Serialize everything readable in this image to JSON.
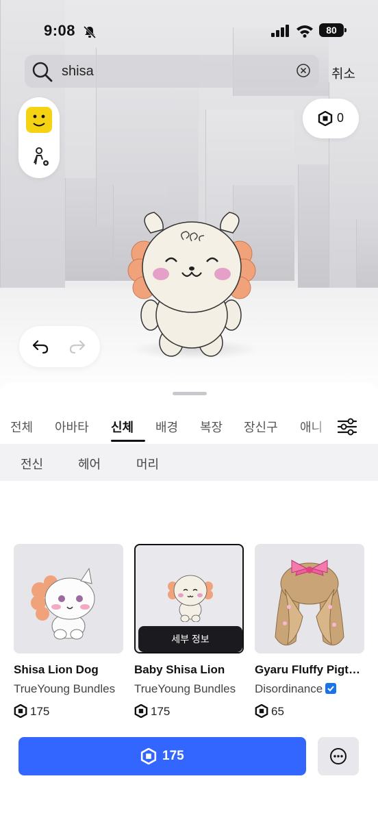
{
  "status": {
    "time": "9:08",
    "battery": "80"
  },
  "search": {
    "value": "shisa",
    "cancel_label": "취소"
  },
  "robux_balance": "0",
  "tabs": [
    {
      "label": "전체",
      "active": false
    },
    {
      "label": "아바타",
      "active": false
    },
    {
      "label": "신체",
      "active": true
    },
    {
      "label": "배경",
      "active": false
    },
    {
      "label": "복장",
      "active": false
    },
    {
      "label": "장신구",
      "active": false
    },
    {
      "label": "애니",
      "active": false
    }
  ],
  "subtabs": [
    {
      "label": "전신"
    },
    {
      "label": "헤어"
    },
    {
      "label": "머리"
    }
  ],
  "items": [
    {
      "name": "Shisa Lion Dog",
      "creator": "TrueYoung Bundles",
      "price": "175",
      "selected": false
    },
    {
      "name": "Baby Shisa Lion",
      "creator": "TrueYoung Bundles",
      "price": "175",
      "selected": true,
      "detail_label": "세부 정보"
    },
    {
      "name": "Gyaru Fluffy Pigtails",
      "creator": "Disordinance",
      "price": "65",
      "selected": false,
      "verified": true
    }
  ],
  "buy_button": {
    "price": "175"
  },
  "colors": {
    "accent": "#3366ff",
    "verified": "#1a73e8"
  }
}
